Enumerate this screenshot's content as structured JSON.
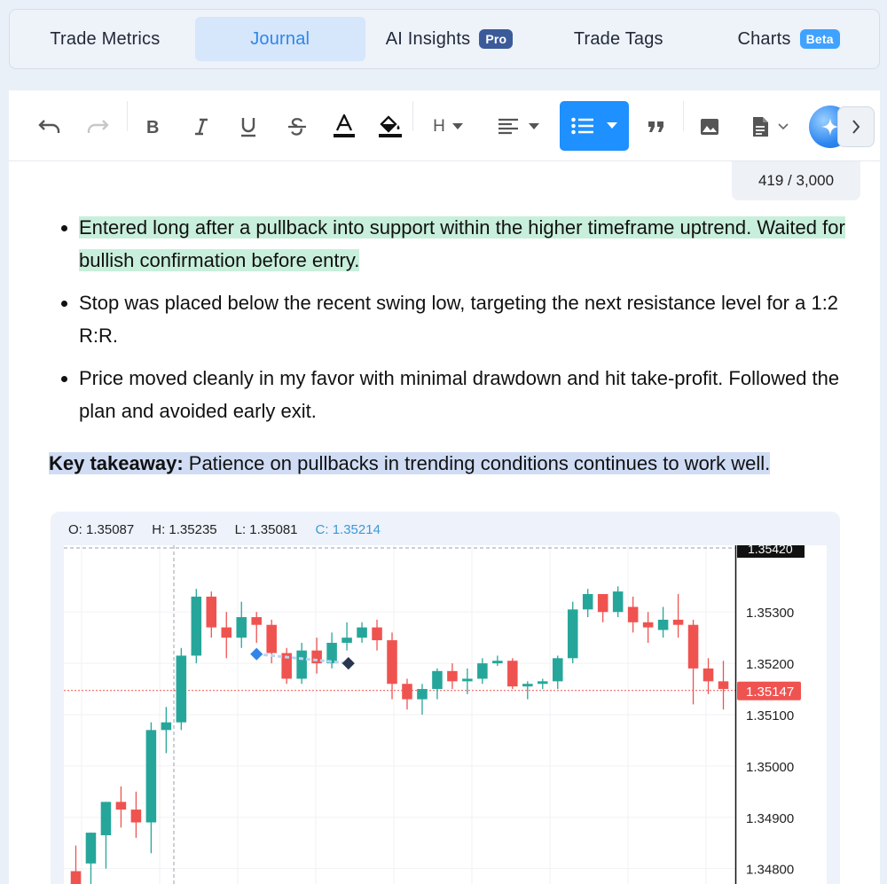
{
  "tabs": [
    {
      "label": "Trade Metrics",
      "badge": "",
      "active": false
    },
    {
      "label": "Journal",
      "badge": "",
      "active": true
    },
    {
      "label": "AI Insights",
      "badge": "Pro",
      "active": false
    },
    {
      "label": "Trade Tags",
      "badge": "",
      "active": false
    },
    {
      "label": "Charts",
      "badge": "Beta",
      "active": false
    }
  ],
  "toolbar": {
    "heading_label": "H",
    "icons": [
      "undo-icon",
      "redo-icon",
      "bold-icon",
      "italic-icon",
      "underline-icon",
      "strikethrough-icon",
      "text-color-icon",
      "highlight-icon",
      "heading-icon",
      "align-icon",
      "bullet-list-icon",
      "quote-icon",
      "image-icon",
      "document-icon",
      "ai-sparkle-icon",
      "chevron-right-icon"
    ]
  },
  "editor": {
    "counter": "419 / 3,000",
    "bullets": [
      "Entered long after a pullback into support within the higher timeframe uptrend. Waited for bullish confirmation before entry.",
      "Stop was placed below the recent swing low, targeting the next resistance level for a 1:2 R:R.",
      "Price moved cleanly in my favor with minimal drawdown and hit take-profit. Followed the plan and avoided early exit."
    ],
    "takeaway_label": "Key takeaway:",
    "takeaway_text": " Patience on pullbacks in trending conditions continues to work well."
  },
  "chart": {
    "ohlc": {
      "o": "O: 1.35087",
      "h": "H: 1.35235",
      "l": "L: 1.35081",
      "c": "C: 1.35214"
    },
    "price_ticks": [
      "1.35300",
      "1.35200",
      "1.35100",
      "1.35000",
      "1.34900",
      "1.34800"
    ],
    "top_label": "1.35420",
    "current_label": "1.35147",
    "colors": {
      "up": "#26a69a",
      "down": "#ef5350",
      "current": "#ef5350"
    }
  },
  "chart_data": {
    "type": "candlestick",
    "ylabel": "",
    "ylim": [
      1.3477,
      1.3543
    ],
    "ticks": [
      1.353,
      1.352,
      1.351,
      1.35,
      1.349,
      1.348
    ],
    "current": 1.35147,
    "candles": [
      {
        "o": 1.34795,
        "h": 1.34845,
        "l": 1.3474,
        "c": 1.34755
      },
      {
        "o": 1.3481,
        "h": 1.34855,
        "l": 1.3475,
        "c": 1.3487
      },
      {
        "o": 1.34865,
        "h": 1.3491,
        "l": 1.348,
        "c": 1.3493
      },
      {
        "o": 1.3493,
        "h": 1.3496,
        "l": 1.3488,
        "c": 1.34915
      },
      {
        "o": 1.34915,
        "h": 1.3495,
        "l": 1.3486,
        "c": 1.3489
      },
      {
        "o": 1.3489,
        "h": 1.35085,
        "l": 1.3483,
        "c": 1.3507
      },
      {
        "o": 1.3507,
        "h": 1.35115,
        "l": 1.35025,
        "c": 1.35085
      },
      {
        "o": 1.35085,
        "h": 1.3523,
        "l": 1.3507,
        "c": 1.35215
      },
      {
        "o": 1.35215,
        "h": 1.35345,
        "l": 1.352,
        "c": 1.3533
      },
      {
        "o": 1.3533,
        "h": 1.3534,
        "l": 1.3525,
        "c": 1.3527
      },
      {
        "o": 1.3527,
        "h": 1.353,
        "l": 1.3521,
        "c": 1.3525
      },
      {
        "o": 1.3525,
        "h": 1.3532,
        "l": 1.3523,
        "c": 1.3529
      },
      {
        "o": 1.3529,
        "h": 1.353,
        "l": 1.3524,
        "c": 1.35275
      },
      {
        "o": 1.35275,
        "h": 1.35285,
        "l": 1.352,
        "c": 1.3522
      },
      {
        "o": 1.3522,
        "h": 1.3523,
        "l": 1.3516,
        "c": 1.3517
      },
      {
        "o": 1.3517,
        "h": 1.3524,
        "l": 1.3516,
        "c": 1.35225
      },
      {
        "o": 1.35225,
        "h": 1.3525,
        "l": 1.3518,
        "c": 1.352
      },
      {
        "o": 1.352,
        "h": 1.3526,
        "l": 1.3519,
        "c": 1.3524
      },
      {
        "o": 1.3524,
        "h": 1.3528,
        "l": 1.35225,
        "c": 1.3525
      },
      {
        "o": 1.3525,
        "h": 1.3528,
        "l": 1.3524,
        "c": 1.3527
      },
      {
        "o": 1.3527,
        "h": 1.35285,
        "l": 1.35225,
        "c": 1.35245
      },
      {
        "o": 1.35245,
        "h": 1.3526,
        "l": 1.3513,
        "c": 1.3516
      },
      {
        "o": 1.3516,
        "h": 1.3517,
        "l": 1.3511,
        "c": 1.3513
      },
      {
        "o": 1.3513,
        "h": 1.3516,
        "l": 1.351,
        "c": 1.3515
      },
      {
        "o": 1.3515,
        "h": 1.3519,
        "l": 1.3513,
        "c": 1.35185
      },
      {
        "o": 1.35185,
        "h": 1.352,
        "l": 1.3515,
        "c": 1.35165
      },
      {
        "o": 1.35165,
        "h": 1.3519,
        "l": 1.3514,
        "c": 1.3517
      },
      {
        "o": 1.3517,
        "h": 1.3521,
        "l": 1.3516,
        "c": 1.352
      },
      {
        "o": 1.352,
        "h": 1.35215,
        "l": 1.35195,
        "c": 1.35205
      },
      {
        "o": 1.35205,
        "h": 1.3521,
        "l": 1.3515,
        "c": 1.35155
      },
      {
        "o": 1.35155,
        "h": 1.35165,
        "l": 1.3513,
        "c": 1.3516
      },
      {
        "o": 1.3516,
        "h": 1.3517,
        "l": 1.3515,
        "c": 1.35165
      },
      {
        "o": 1.35165,
        "h": 1.35215,
        "l": 1.3515,
        "c": 1.3521
      },
      {
        "o": 1.3521,
        "h": 1.3532,
        "l": 1.352,
        "c": 1.35305
      },
      {
        "o": 1.35305,
        "h": 1.35345,
        "l": 1.3529,
        "c": 1.35335
      },
      {
        "o": 1.35335,
        "h": 1.3533,
        "l": 1.3528,
        "c": 1.353
      },
      {
        "o": 1.353,
        "h": 1.3535,
        "l": 1.3529,
        "c": 1.3534
      },
      {
        "o": 1.3531,
        "h": 1.3533,
        "l": 1.3526,
        "c": 1.3528
      },
      {
        "o": 1.3528,
        "h": 1.353,
        "l": 1.3524,
        "c": 1.3527
      },
      {
        "o": 1.35265,
        "h": 1.3531,
        "l": 1.3525,
        "c": 1.35285
      },
      {
        "o": 1.35285,
        "h": 1.35335,
        "l": 1.3525,
        "c": 1.35275
      },
      {
        "o": 1.35275,
        "h": 1.35285,
        "l": 1.3512,
        "c": 1.3519
      },
      {
        "o": 1.3519,
        "h": 1.3521,
        "l": 1.3514,
        "c": 1.35165
      },
      {
        "o": 1.35165,
        "h": 1.35205,
        "l": 1.3511,
        "c": 1.3515
      }
    ]
  }
}
